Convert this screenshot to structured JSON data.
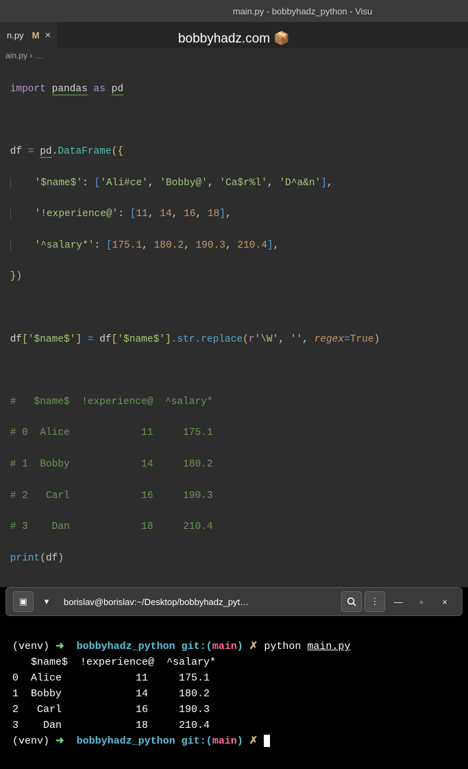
{
  "titlebar": {
    "text": "main.py - bobbyhadz_python - Visu"
  },
  "tab": {
    "filename": "n.py",
    "modified_indicator": "M",
    "close": "×"
  },
  "watermark": {
    "text": "bobbyhadz.com 📦"
  },
  "breadcrumb": {
    "file": "ain.py",
    "sep": "›",
    "ellipsis": "…"
  },
  "code": {
    "l1": {
      "kw_import": "import",
      "mod1": "pandas",
      "kw_as": "as",
      "mod2": "pd"
    },
    "l3": {
      "var": "df",
      "op_eq": "=",
      "pd": "pd",
      "dot": ".",
      "fn": "DataFrame",
      "open": "({"
    },
    "l4": {
      "key": "'$name$'",
      "colon": ":",
      "vals": [
        "'Ali#ce'",
        "'Bobby@'",
        "'Ca$r%l'",
        "'D^a&n'"
      ]
    },
    "l5": {
      "key": "'!experience@'",
      "colon": ":",
      "vals": [
        "11",
        "14",
        "16",
        "18"
      ]
    },
    "l6": {
      "key": "'^salary*'",
      "colon": ":",
      "vals": [
        "175.1",
        "180.2",
        "190.3",
        "210.4"
      ]
    },
    "l7": {
      "close": "})"
    },
    "l9": {
      "lhs1": "df",
      "lhs2": "[",
      "lhs3": "'$name$'",
      "lhs4": "]",
      "eq": "=",
      "rhs1": "df",
      "rhs2": "[",
      "rhs3": "'$name$'",
      "rhs4": "]",
      "str": ".str.",
      "repl": "replace",
      "p1": "(",
      "raw": "r",
      "pat": "'\\W'",
      "c1": ",",
      "empty": "''",
      "c2": ",",
      "regex": "regex",
      "eq2": "=",
      "true": "True",
      "p2": ")"
    },
    "c1": "#   $name$  !experience@  ^salary*",
    "c2": "# 0  Alice            11     175.1",
    "c3": "# 1  Bobby            14     180.2",
    "c4": "# 2   Carl            16     190.3",
    "c5": "# 3    Dan            18     210.4",
    "l16": {
      "print": "print",
      "open": "(",
      "arg": "df",
      "close": ")"
    }
  },
  "terminal": {
    "header_title": "borislav@borislav:~/Desktop/bobbyhadz_pyt…",
    "prompt1": {
      "venv": "(venv)",
      "arrow": "➜",
      "dir": "bobbyhadz_python",
      "git": "git:(",
      "branch": "main",
      "gitclose": ")",
      "x": "✗",
      "cmd": "python",
      "file": "main.py"
    },
    "out1": "   $name$  !experience@  ^salary*",
    "out2": "0  Alice            11     175.1",
    "out3": "1  Bobby            14     180.2",
    "out4": "2   Carl            16     190.3",
    "out5": "3    Dan            18     210.4",
    "prompt2": {
      "venv": "(venv)",
      "arrow": "➜",
      "dir": "bobbyhadz_python",
      "git": "git:(",
      "branch": "main",
      "gitclose": ")",
      "x": "✗"
    }
  }
}
